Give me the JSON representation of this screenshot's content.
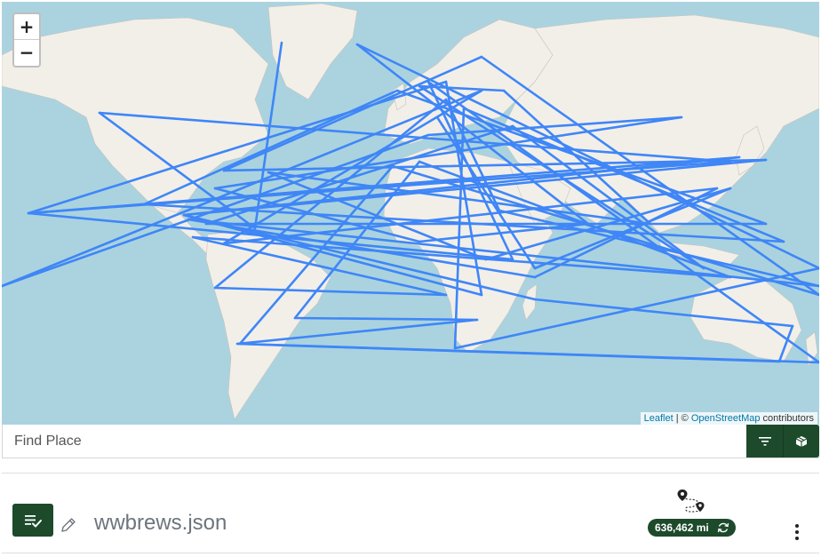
{
  "map": {
    "zoom_in_label": "+",
    "zoom_out_label": "−",
    "attribution": {
      "leaflet": "Leaflet",
      "separator": " | © ",
      "osm": "OpenStreetMap",
      "suffix": " contributors"
    },
    "route_color": "#3f86f7",
    "water_color": "#aad3df",
    "land_color": "#f2efe9"
  },
  "search": {
    "placeholder": "Find Place",
    "filter_icon": "filter-icon",
    "cube_icon": "cube-icon"
  },
  "file": {
    "name": "wwbrews.json",
    "list_icon": "list-check-icon",
    "edit_icon": "pencil-icon"
  },
  "route": {
    "distance": "636,462 mi",
    "route_icon": "route-pins-icon",
    "refresh_icon": "refresh-icon",
    "menu_icon": "kebab-menu-icon"
  },
  "theme": {
    "accent": "#1d4a2b"
  }
}
